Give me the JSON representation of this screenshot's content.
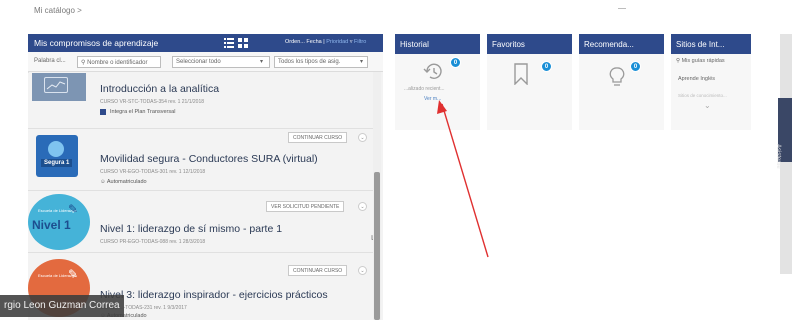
{
  "breadcrumb": "Mi catálogo >",
  "main": {
    "title": "Mis compromisos de aprendizaje",
    "sort_text": "Orden... Fecha |",
    "sort_link": "Prioridad",
    "filter_link": "Filtro",
    "filters": {
      "keyword": "Palabra cl...",
      "owner": "Nombre o identificador",
      "select_all": "Seleccionar todo",
      "all_types": "Todos los tipos de asig."
    },
    "courses": [
      {
        "title": "Introducción a la analítica",
        "meta": "CURSO VR-STC-TODAS-354 rev. 1 21/1/2018",
        "tag": "Integra el Plan Transversal",
        "button": ""
      },
      {
        "title": "Movilidad segura - Conductores SURA (virtual)",
        "meta": "CURSO VR-EGO-TODAS-301 rev. 1 12/1/2018",
        "tag": "Automatriculado",
        "button": "CONTINUAR CURSO",
        "thumb_label": "Segura 1"
      },
      {
        "title": "Nivel 1: liderazgo de sí mismo - parte 1",
        "meta": "CURSO PR-EGO-TODAS-088 rev. 1 28/3/2018",
        "tag": "",
        "button": "VER SOLICITUD PENDIENTE",
        "thumb_label": "Nivel 1",
        "thumb_small": "Escuela de Liderazgo"
      },
      {
        "title": "Nivel 3: liderazgo inspirador - ejercicios prácticos",
        "meta": "CURSO ...-TODAS-231 rev. 1 9/3/2017",
        "tag": "Automatriculado",
        "button": "CONTINUAR CURSO",
        "thumb_small": "Escuela de Liderazgo"
      }
    ]
  },
  "panels": {
    "historial": {
      "title": "Historial",
      "badge": "0",
      "link1": "...alizado recient...",
      "link2": "Ver m..."
    },
    "favoritos": {
      "title": "Favoritos",
      "badge": "0"
    },
    "recomenda": {
      "title": "Recomenda...",
      "badge": "0"
    },
    "sitios": {
      "title": "Sitios de Int...",
      "items": [
        "Mis guías rápidas",
        "Aprende Inglés",
        "Sitios de conocimiento..."
      ]
    }
  },
  "side_tab": "Asistente",
  "overlay_name": "rgio Leon Guzman Correa",
  "colors": {
    "header": "#2e4a8b",
    "badge": "#1a8fd6",
    "arrow": "#e03030"
  }
}
